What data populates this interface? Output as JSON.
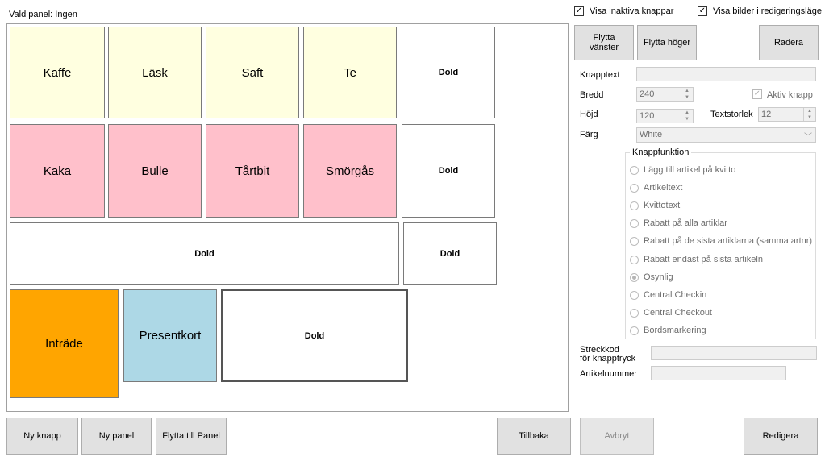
{
  "header": {
    "selected_panel": "Vald panel: Ingen"
  },
  "options": {
    "show_inactive": {
      "label": "Visa inaktiva knappar",
      "checked": true
    },
    "show_images": {
      "label": "Visa bilder i redigeringsläge",
      "checked": true
    }
  },
  "tiles": {
    "kaffe": "Kaffe",
    "lask": "Läsk",
    "saft": "Saft",
    "te": "Te",
    "dold1": "Dold",
    "kaka": "Kaka",
    "bulle": "Bulle",
    "tartbit": "Tårtbit",
    "smorgas": "Smörgås",
    "dold2": "Dold",
    "dold_wide": "Dold",
    "dold3": "Dold",
    "intrade": "Inträde",
    "presentkort": "Presentkort",
    "dold4": "Dold"
  },
  "colors": {
    "yellow": "#ffffe0",
    "pink": "#ffc0cb",
    "orange": "#ffa500",
    "lightblue": "#add8e6"
  },
  "editor": {
    "move_left": "Flytta vänster",
    "move_right": "Flytta höger",
    "delete": "Radera",
    "button_text_label": "Knapptext",
    "button_text_value": "",
    "width_label": "Bredd",
    "width_value": "240",
    "height_label": "Höjd",
    "height_value": "120",
    "active_label": "Aktiv knapp",
    "active_checked": true,
    "font_size_label": "Textstorlek",
    "font_size_value": "12",
    "color_label": "Färg",
    "color_value": "White",
    "function_group_label": "Knappfunktion",
    "functions": [
      {
        "label": "Lägg till artikel på kvitto",
        "selected": false
      },
      {
        "label": "Artikeltext",
        "selected": false
      },
      {
        "label": "Kvittotext",
        "selected": false
      },
      {
        "label": "Rabatt på alla artiklar",
        "selected": false
      },
      {
        "label": "Rabatt på de sista artiklarna (samma artnr)",
        "selected": false
      },
      {
        "label": "Rabatt endast på sista artikeln",
        "selected": false
      },
      {
        "label": "Osynlig",
        "selected": true
      },
      {
        "label": "Central Checkin",
        "selected": false
      },
      {
        "label": "Central Checkout",
        "selected": false
      },
      {
        "label": "Bordsmarkering",
        "selected": false
      }
    ],
    "barcode_label_1": "Streckkod",
    "barcode_label_2": "för knapptryck",
    "barcode_value": "",
    "article_number_label": "Artikelnummer",
    "article_number_value": ""
  },
  "bottom": {
    "new_button": "Ny knapp",
    "new_panel": "Ny panel",
    "move_to_panel": "Flytta till Panel",
    "back": "Tillbaka",
    "cancel": "Avbryt",
    "edit": "Redigera"
  }
}
